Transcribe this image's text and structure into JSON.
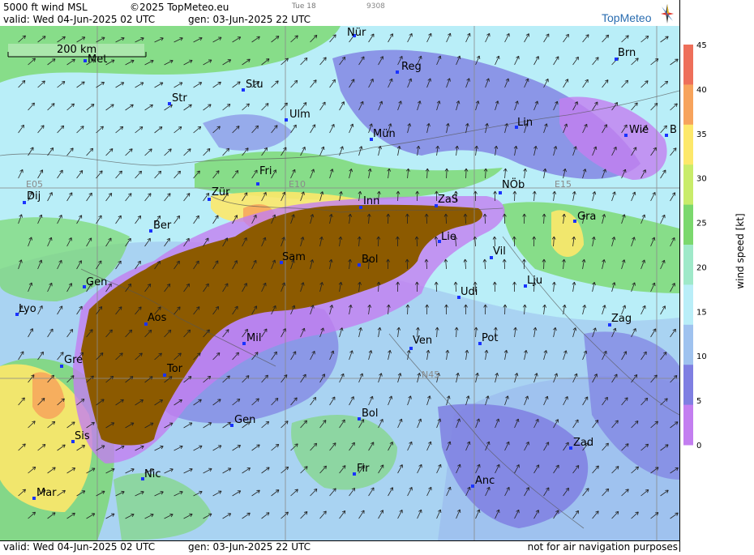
{
  "header": {
    "product": "5000 ft wind MSL",
    "copyright": "©2025 TopMeteo.eu",
    "small_label": "Tue 18",
    "small_code": "9308",
    "valid": "valid:  Wed  04-Jun-2025  02 UTC",
    "generated": "gen: 03-Jun-2025 22 UTC",
    "logo": "TopMeteo"
  },
  "footer": {
    "valid": "valid:  Wed  04-Jun-2025  02 UTC",
    "generated": "gen: 03-Jun-2025 22 UTC",
    "note": "not for air navigation purposes"
  },
  "scale_bar": "200 km",
  "grid_labels": [
    "E05",
    "E10",
    "E15",
    "N45"
  ],
  "colorbar": {
    "title": "wind speed [kt]",
    "ticks": [
      "45",
      "40",
      "35",
      "30",
      "25",
      "20",
      "15",
      "10",
      "5",
      "0"
    ],
    "colors": [
      "#ee6f5a",
      "#f7a35c",
      "#fde86a",
      "#c9ec6a",
      "#7bd86d",
      "#9fe9c9",
      "#b9eef8",
      "#9fc2ef",
      "#7f7fe2",
      "#c37ef0"
    ]
  },
  "cities": [
    "Nür",
    "Met",
    "Reg",
    "Brn",
    "Stu",
    "Str",
    "Ulm",
    "Mün",
    "Lin",
    "Wie",
    "B",
    "Fri",
    "Dij",
    "Zür",
    "Inn",
    "ZaS",
    "NÖb",
    "Gra",
    "Ber",
    "Sam",
    "Bol",
    "Lie",
    "Vil",
    "Gen",
    "Lju",
    "Lyo",
    "Udi",
    "Aos",
    "Zag",
    "Mil",
    "Ven",
    "Pot",
    "Gre",
    "Tor",
    "Gen",
    "Bol",
    "Sis",
    "Zad",
    "Nic",
    "Fir",
    "Anc",
    "Mar"
  ]
}
